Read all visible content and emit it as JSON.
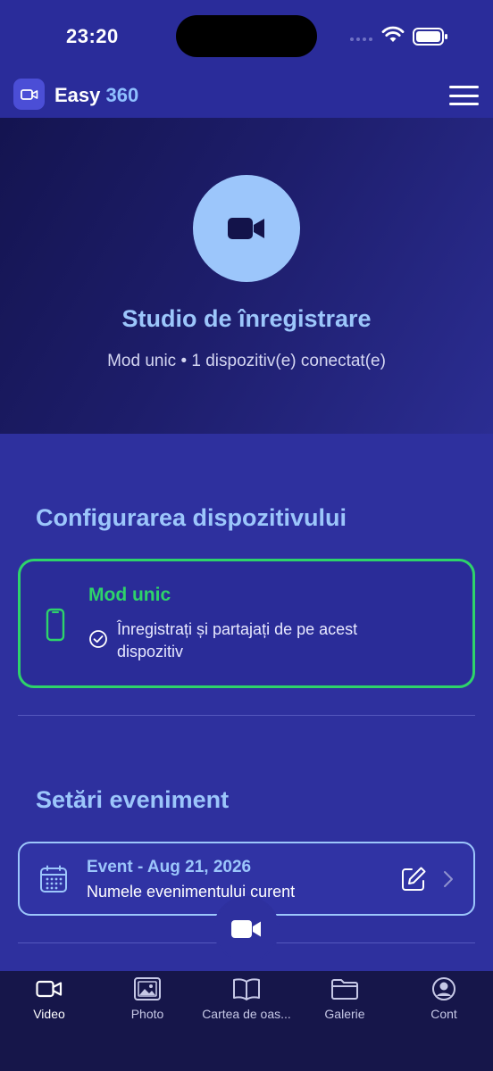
{
  "status_bar": {
    "time": "23:20"
  },
  "header": {
    "title_main": "Easy ",
    "title_accent": "360"
  },
  "hero": {
    "title": "Studio de înregistrare",
    "subtitle": "Mod unic • 1 dispozitiv(e) conectat(e)"
  },
  "device_setup": {
    "section_title": "Configurarea dispozitivului",
    "mode_title": "Mod unic",
    "mode_description": "Înregistrați și partajați de pe acest dispozitiv"
  },
  "event_settings": {
    "section_title": "Setări eveniment",
    "event_title": "Event - Aug 21, 2026",
    "event_subtitle": "Numele evenimentului curent"
  },
  "tabs": [
    {
      "label": "Video",
      "icon": "video-icon",
      "active": true
    },
    {
      "label": "Photo",
      "icon": "photo-icon",
      "active": false
    },
    {
      "label": "Cartea de oas...",
      "icon": "book-icon",
      "active": false
    },
    {
      "label": "Galerie",
      "icon": "folder-icon",
      "active": false
    },
    {
      "label": "Cont",
      "icon": "account-icon",
      "active": false
    }
  ],
  "colors": {
    "background": "#2e309e",
    "accent_blue": "#9cc6fb",
    "success_green": "#2ed36a",
    "tab_bar": "#16164a"
  }
}
